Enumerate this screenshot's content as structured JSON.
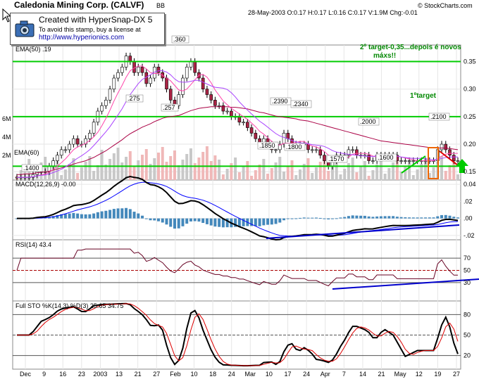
{
  "header": {
    "title": "Caledonia Mining Corp. (CALVF)",
    "exchange": "BB",
    "quote": "28-May-2003 O:0.17 H:0.17 L:0.16 C:0.17 V:1.9M Chg:-0.01",
    "copyright": "© StockCharts.com"
  },
  "stamp": {
    "line1": "Created with HyperSnap-DX 5",
    "line2": "To avoid this stamp, buy a license at",
    "line3": "http://www.hyperionics.com"
  },
  "colors": {
    "up_candle": "#ffffff",
    "down_candle": "#aa2244",
    "target_line": "#00cc00",
    "trend_line": "#0000cc",
    "macd": "#000000",
    "signal": "#0000ff",
    "ema50": "#aa0044",
    "stoch_d": "#dd0000",
    "annotation": "#008800",
    "volume": "#c8c8c8"
  },
  "chart_data": [
    {
      "type": "candlestick",
      "panel": "price",
      "indicator_label": "EMA(50) .19",
      "ema60_label": "EMA(60)",
      "ylim": [
        0.135,
        0.38
      ],
      "yticks": [
        "0.35",
        "0.30",
        "0.25",
        "0.20",
        "0.15"
      ],
      "volume_ticks": [
        "6M",
        "4M",
        "2M"
      ],
      "hlines": [
        {
          "y": 0.35,
          "label": "2º target-0,35...depois é novos máxs!!"
        },
        {
          "y": 0.25,
          "label": "1ºtarget"
        },
        {
          "y": 0.16
        }
      ],
      "annotations": [
        ".360",
        ".275",
        ".257",
        ".2390",
        ".2340",
        ".2000",
        ".2100",
        ".1850",
        ".1800",
        ".1570",
        ".1600",
        ".1400"
      ],
      "close": [
        0.14,
        0.14,
        0.14,
        0.14,
        0.145,
        0.15,
        0.15,
        0.15,
        0.16,
        0.17,
        0.18,
        0.19,
        0.19,
        0.2,
        0.21,
        0.2,
        0.2,
        0.21,
        0.22,
        0.24,
        0.26,
        0.27,
        0.28,
        0.3,
        0.32,
        0.33,
        0.34,
        0.36,
        0.35,
        0.33,
        0.34,
        0.33,
        0.31,
        0.32,
        0.34,
        0.33,
        0.32,
        0.3,
        0.28,
        0.27,
        0.29,
        0.32,
        0.34,
        0.35,
        0.33,
        0.32,
        0.3,
        0.29,
        0.28,
        0.27,
        0.27,
        0.26,
        0.26,
        0.25,
        0.25,
        0.24,
        0.24,
        0.23,
        0.22,
        0.21,
        0.2,
        0.21,
        0.2,
        0.19,
        0.19,
        0.2,
        0.22,
        0.21,
        0.2,
        0.2,
        0.2,
        0.2,
        0.19,
        0.19,
        0.19,
        0.18,
        0.17,
        0.16,
        0.17,
        0.18,
        0.18,
        0.18,
        0.19,
        0.19,
        0.18,
        0.18,
        0.18,
        0.17,
        0.17,
        0.18,
        0.18,
        0.18,
        0.18,
        0.18,
        0.17,
        0.17,
        0.17,
        0.17,
        0.17,
        0.17,
        0.17,
        0.17,
        0.17,
        0.17,
        0.19,
        0.2,
        0.19,
        0.18,
        0.17,
        0.17
      ],
      "ema50": [
        0.145,
        0.145,
        0.146,
        0.146,
        0.147,
        0.148,
        0.149,
        0.15,
        0.151,
        0.153,
        0.155,
        0.157,
        0.159,
        0.161,
        0.164,
        0.166,
        0.168,
        0.17,
        0.173,
        0.176,
        0.18,
        0.184,
        0.188,
        0.193,
        0.198,
        0.203,
        0.208,
        0.214,
        0.219,
        0.223,
        0.227,
        0.231,
        0.234,
        0.237,
        0.241,
        0.244,
        0.247,
        0.249,
        0.25,
        0.251,
        0.252,
        0.255,
        0.258,
        0.261,
        0.263,
        0.265,
        0.266,
        0.267,
        0.268,
        0.268,
        0.268,
        0.268,
        0.268,
        0.267,
        0.267,
        0.266,
        0.265,
        0.264,
        0.262,
        0.26,
        0.258,
        0.257,
        0.255,
        0.253,
        0.251,
        0.25,
        0.249,
        0.248,
        0.247,
        0.246,
        0.244,
        0.243,
        0.242,
        0.24,
        0.238,
        0.236,
        0.234,
        0.232,
        0.23,
        0.228,
        0.226,
        0.224,
        0.222,
        0.22,
        0.218,
        0.216,
        0.214,
        0.212,
        0.21,
        0.208,
        0.206,
        0.205,
        0.204,
        0.203,
        0.202,
        0.201,
        0.2,
        0.199,
        0.198,
        0.197,
        0.196,
        0.195,
        0.194,
        0.193,
        0.193,
        0.193,
        0.193,
        0.192,
        0.191,
        0.19
      ],
      "x_labels": [
        "Dec",
        "9",
        "16",
        "23",
        "2003",
        "13",
        "21",
        "27",
        "Feb",
        "10",
        "18",
        "24",
        "Mar",
        "10",
        "17",
        "24",
        "Apr",
        "7",
        "14",
        "21",
        "May",
        "12",
        "19",
        "27"
      ]
    },
    {
      "type": "line",
      "panel": "macd",
      "label": "MACD(12,26,9) -0.00",
      "ylim": [
        -0.025,
        0.045
      ],
      "yticks": [
        "0.04",
        ".02",
        ".00",
        "-.02"
      ]
    },
    {
      "type": "line",
      "panel": "rsi",
      "label": "RSI(14) 43.4",
      "ylim": [
        0,
        100
      ],
      "yticks": [
        "70",
        "50",
        "30"
      ],
      "levels": [
        70,
        50,
        30
      ]
    },
    {
      "type": "line",
      "panel": "stochastic",
      "label": "Full STO %K(14,3) %D(3) 25.65 34.75",
      "ylim": [
        0,
        100
      ],
      "yticks": [
        "80",
        "50",
        "20"
      ],
      "levels": [
        80,
        50,
        20
      ]
    }
  ]
}
